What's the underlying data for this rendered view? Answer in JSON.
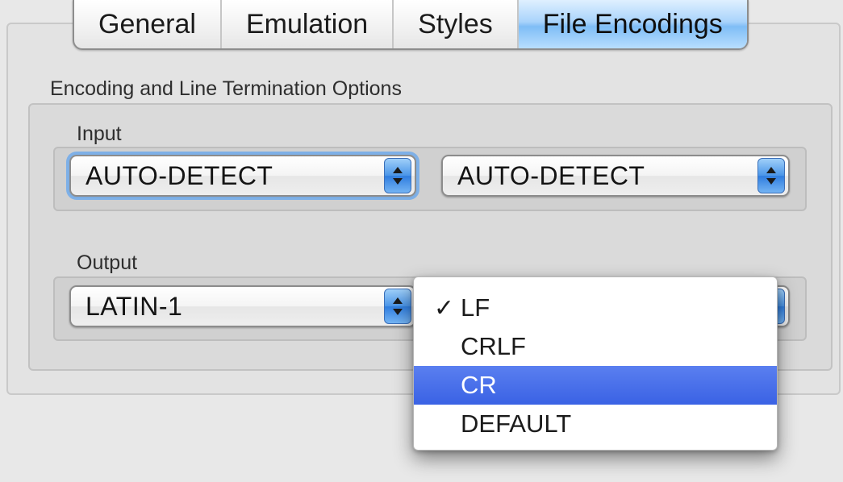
{
  "tabs": [
    {
      "label": "General"
    },
    {
      "label": "Emulation"
    },
    {
      "label": "Styles"
    },
    {
      "label": "File Encodings",
      "selected": true
    }
  ],
  "group": {
    "title": "Encoding and Line Termination Options",
    "input": {
      "label": "Input",
      "encoding": "AUTO-DETECT",
      "line_ending": "AUTO-DETECT"
    },
    "output": {
      "label": "Output",
      "encoding": "LATIN-1"
    }
  },
  "dropdown": {
    "options": [
      {
        "label": "LF",
        "checked": true,
        "highlighted": false
      },
      {
        "label": "CRLF",
        "checked": false,
        "highlighted": false
      },
      {
        "label": "CR",
        "checked": false,
        "highlighted": true
      },
      {
        "label": "DEFAULT",
        "checked": false,
        "highlighted": false
      }
    ],
    "check_glyph": "✓"
  },
  "colors": {
    "selected_tab": "#8cc4f7",
    "menu_highlight": "#3d63e6",
    "stepper": "#4a95e8"
  },
  "icons": {
    "stepper": "up-down-arrows-icon",
    "check": "checkmark-icon"
  }
}
